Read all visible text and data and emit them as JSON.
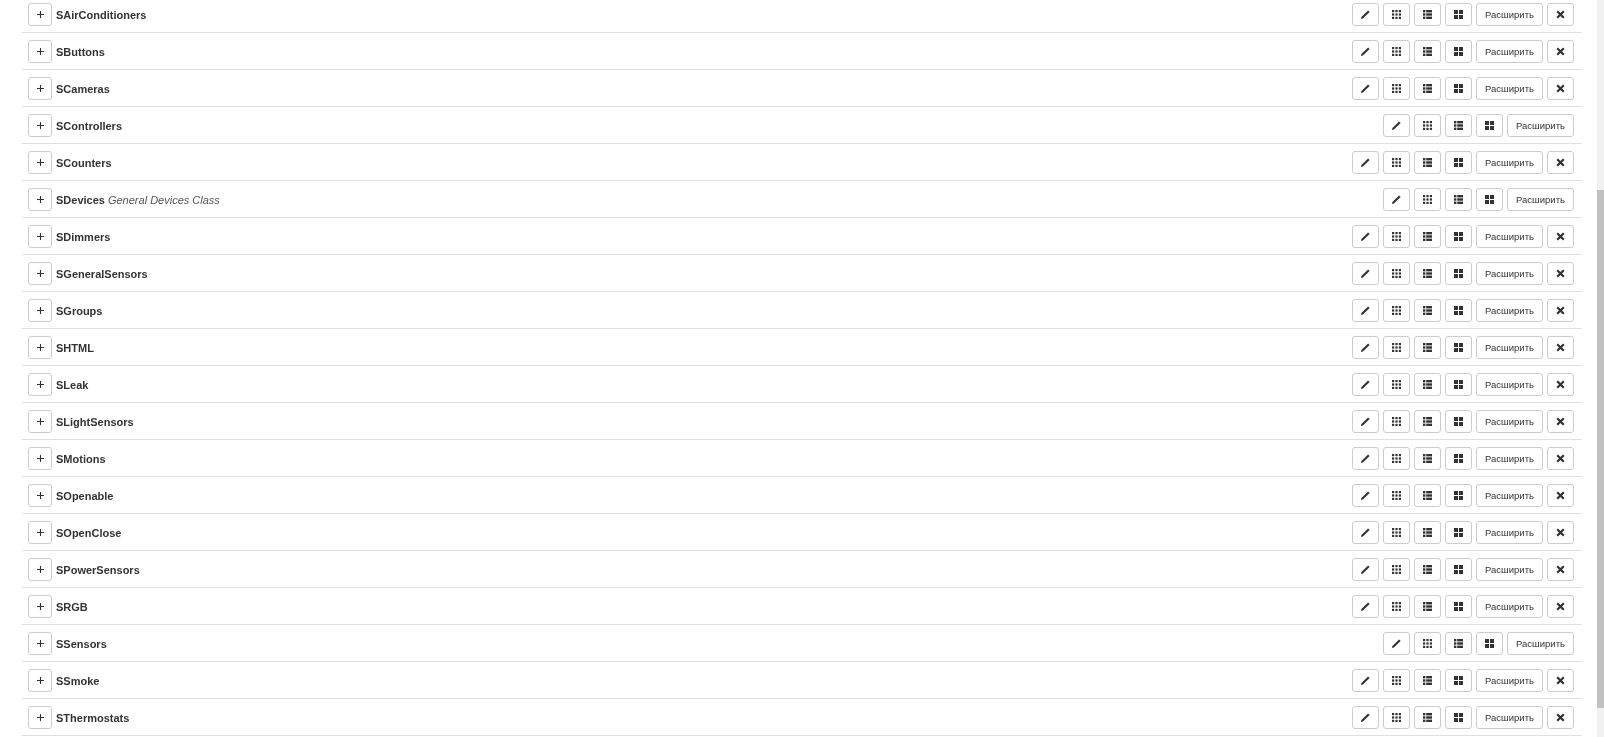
{
  "rows": [
    {
      "name": "SAirConditioners",
      "expand_label": "Расширить",
      "removable": true
    },
    {
      "name": "SButtons",
      "expand_label": "Расширить",
      "removable": true
    },
    {
      "name": "SCameras",
      "expand_label": "Расширить",
      "removable": true
    },
    {
      "name": "SControllers",
      "expand_label": "Расширить",
      "removable": false
    },
    {
      "name": "SCounters",
      "expand_label": "Расширить",
      "removable": true
    },
    {
      "name": "SDevices",
      "description": "General Devices Class",
      "expand_label": "Расширить",
      "removable": false
    },
    {
      "name": "SDimmers",
      "expand_label": "Расширить",
      "removable": true
    },
    {
      "name": "SGeneralSensors",
      "expand_label": "Расширить",
      "removable": true
    },
    {
      "name": "SGroups",
      "expand_label": "Расширить",
      "removable": true
    },
    {
      "name": "SHTML",
      "expand_label": "Расширить",
      "removable": true
    },
    {
      "name": "SLeak",
      "expand_label": "Расширить",
      "removable": true
    },
    {
      "name": "SLightSensors",
      "expand_label": "Расширить",
      "removable": true
    },
    {
      "name": "SMotions",
      "expand_label": "Расширить",
      "removable": true
    },
    {
      "name": "SOpenable",
      "expand_label": "Расширить",
      "removable": true
    },
    {
      "name": "SOpenClose",
      "expand_label": "Расширить",
      "removable": true
    },
    {
      "name": "SPowerSensors",
      "expand_label": "Расширить",
      "removable": true
    },
    {
      "name": "SRGB",
      "expand_label": "Расширить",
      "removable": true
    },
    {
      "name": "SSensors",
      "expand_label": "Расширить",
      "removable": false
    },
    {
      "name": "SSmoke",
      "expand_label": "Расширить",
      "removable": true
    },
    {
      "name": "SThermostats",
      "expand_label": "Расширить",
      "removable": true
    }
  ]
}
